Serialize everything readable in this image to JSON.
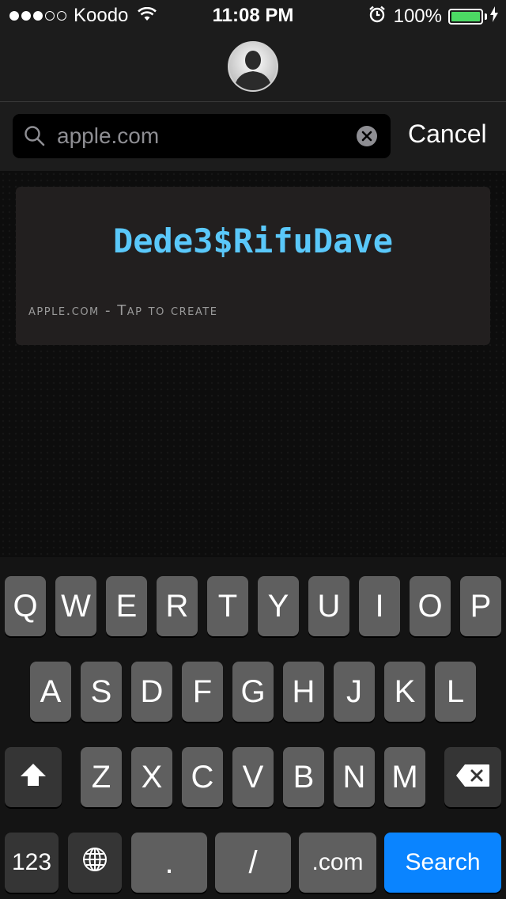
{
  "status_bar": {
    "signal_dots": [
      true,
      true,
      true,
      false,
      false
    ],
    "carrier": "Koodo",
    "wifi_icon": "wifi-icon",
    "time": "11:08 PM",
    "alarm_icon": "alarm-clock-icon",
    "battery_percent": "100%",
    "battery_level": 1.0,
    "battery_color": "#4cd964",
    "charging_icon": "lightning-bolt-icon"
  },
  "header": {
    "avatar_icon": "user-avatar-icon"
  },
  "search": {
    "value": "apple.com",
    "search_icon": "magnifying-glass-icon",
    "clear_icon": "clear-x-icon",
    "cancel_label": "Cancel"
  },
  "result": {
    "password": "Dede3$RifuDave",
    "password_color": "#5ac8fa",
    "caption": "apple.com - Tap to create"
  },
  "keyboard": {
    "row1": [
      "Q",
      "W",
      "E",
      "R",
      "T",
      "Y",
      "U",
      "I",
      "O",
      "P"
    ],
    "row2": [
      "A",
      "S",
      "D",
      "F",
      "G",
      "H",
      "J",
      "K",
      "L"
    ],
    "row3": [
      "Z",
      "X",
      "C",
      "V",
      "B",
      "N",
      "M"
    ],
    "shift_icon": "shift-arrow-icon",
    "backspace_icon": "backspace-icon",
    "numbers_label": "123",
    "globe_icon": "globe-icon",
    "dot_label": ".",
    "slash_label": "/",
    "dotcom_label": ".com",
    "search_label": "Search",
    "search_color": "#0a84ff"
  }
}
